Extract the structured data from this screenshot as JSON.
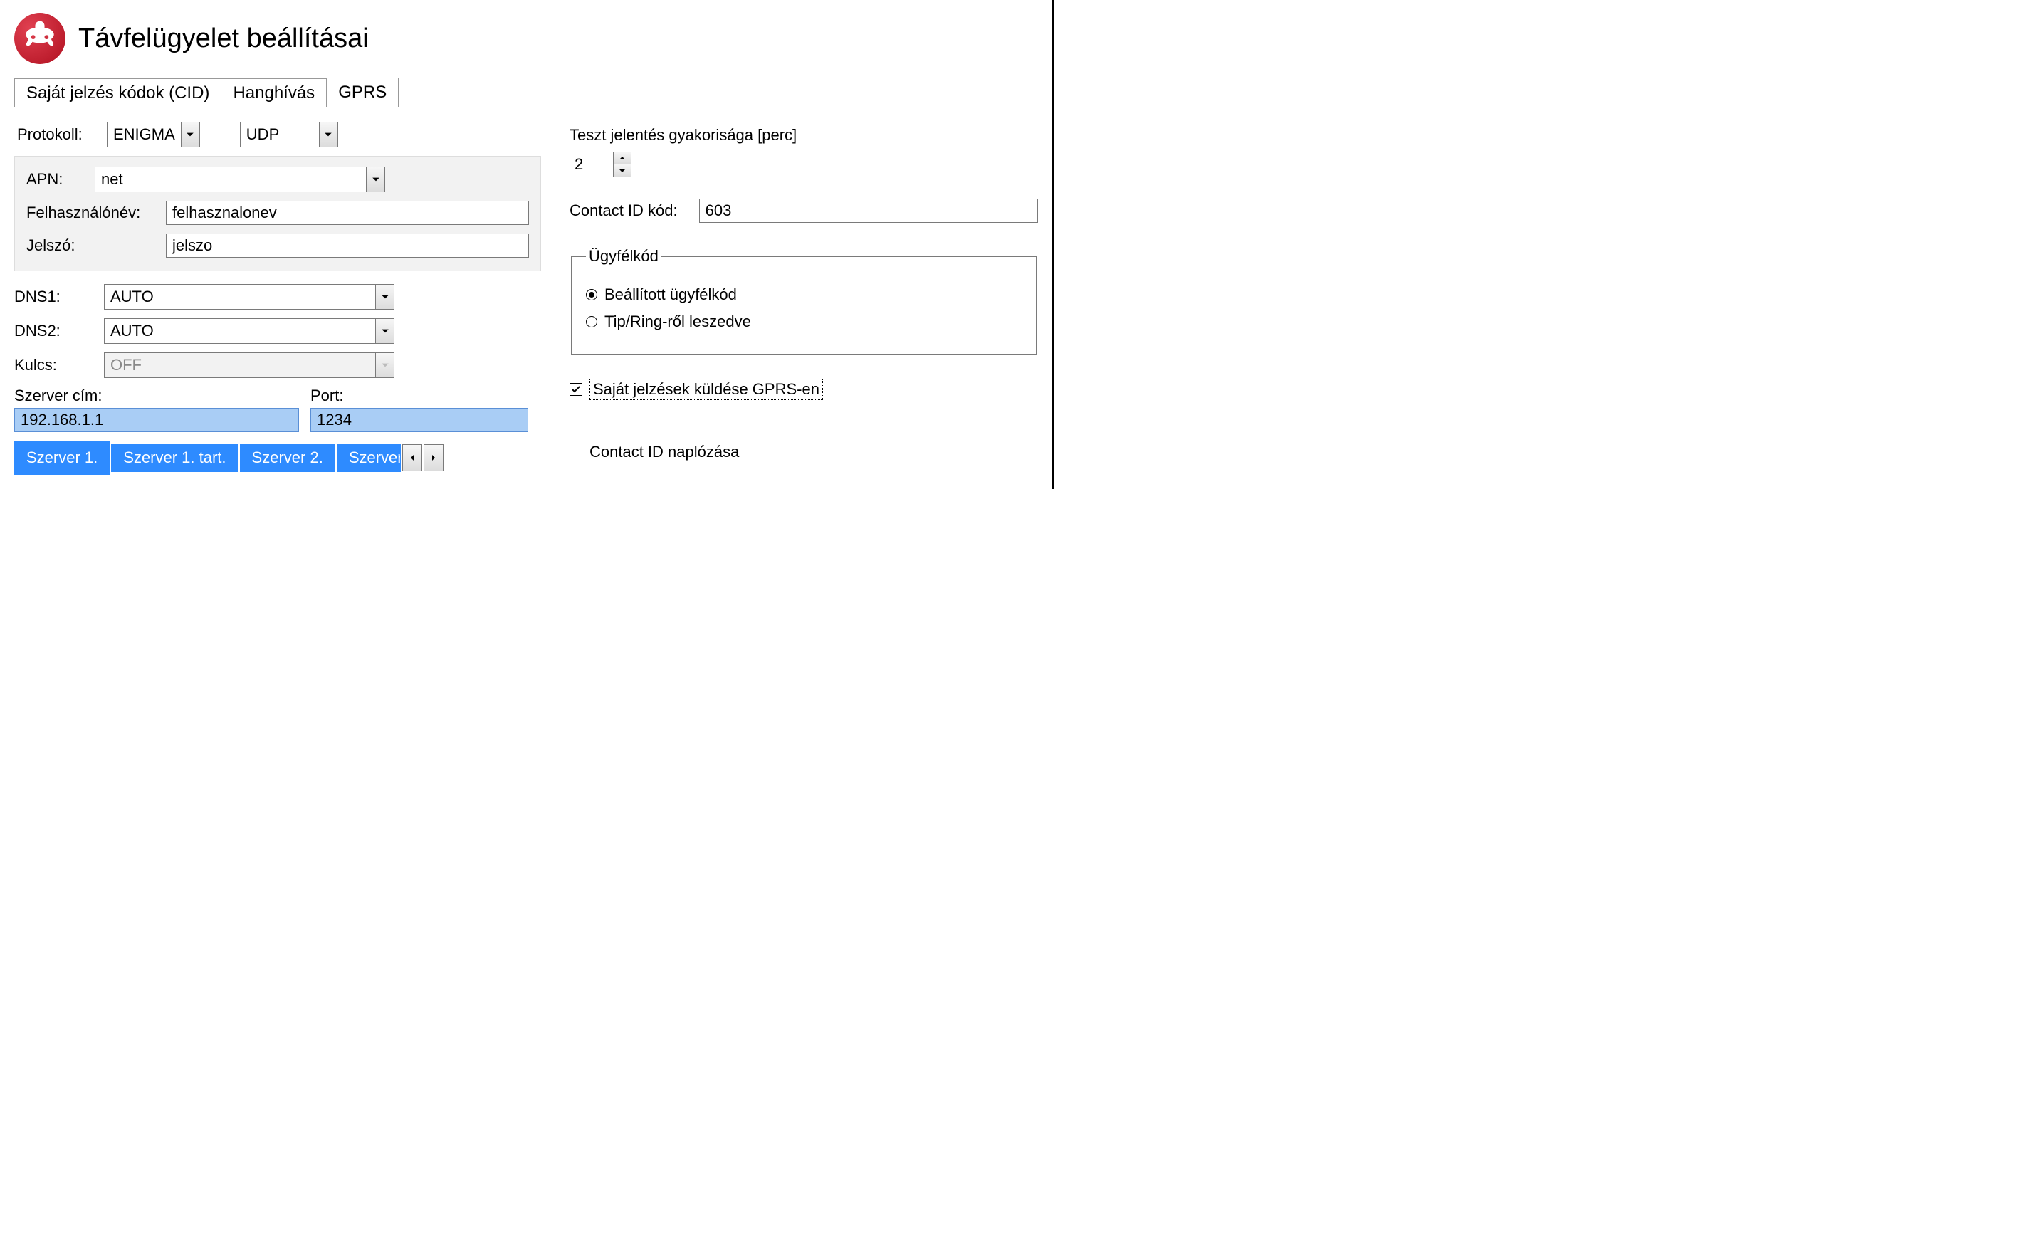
{
  "header": {
    "title": "Távfelügyelet beállításai"
  },
  "tabs": {
    "cid": "Saját jelzés kódok (CID)",
    "hang": "Hanghívás",
    "gprs": "GPRS"
  },
  "left": {
    "protocol_label": "Protokoll:",
    "protocol_value": "ENIGMA",
    "transport_value": "UDP",
    "apn_label": "APN:",
    "apn_value": "net",
    "user_label": "Felhasználónév:",
    "user_value": "felhasznalonev",
    "pass_label": "Jelszó:",
    "pass_value": "jelszo",
    "dns1_label": "DNS1:",
    "dns1_value": "AUTO",
    "dns2_label": "DNS2:",
    "dns2_value": "AUTO",
    "key_label": "Kulcs:",
    "key_value": "OFF",
    "server_addr_label": "Szerver cím:",
    "port_label": "Port:",
    "server_addr_value": "192.168.1.1",
    "port_value": "1234",
    "subtabs": {
      "s1": "Szerver 1.",
      "s1t": "Szerver 1. tart.",
      "s2": "Szerver 2.",
      "s2t_trunc": "Szerver"
    }
  },
  "right": {
    "test_freq_label": "Teszt jelentés gyakorisága [perc]",
    "test_freq_value": "2",
    "cid_code_label": "Contact ID kód:",
    "cid_code_value": "603",
    "group_legend": "Ügyfélkód",
    "radio_set": "Beállított ügyfélkód",
    "radio_tip": "Tip/Ring-ről leszedve",
    "chk_send": "Saját jelzések küldése GPRS-en",
    "chk_log": "Contact ID naplózása"
  }
}
